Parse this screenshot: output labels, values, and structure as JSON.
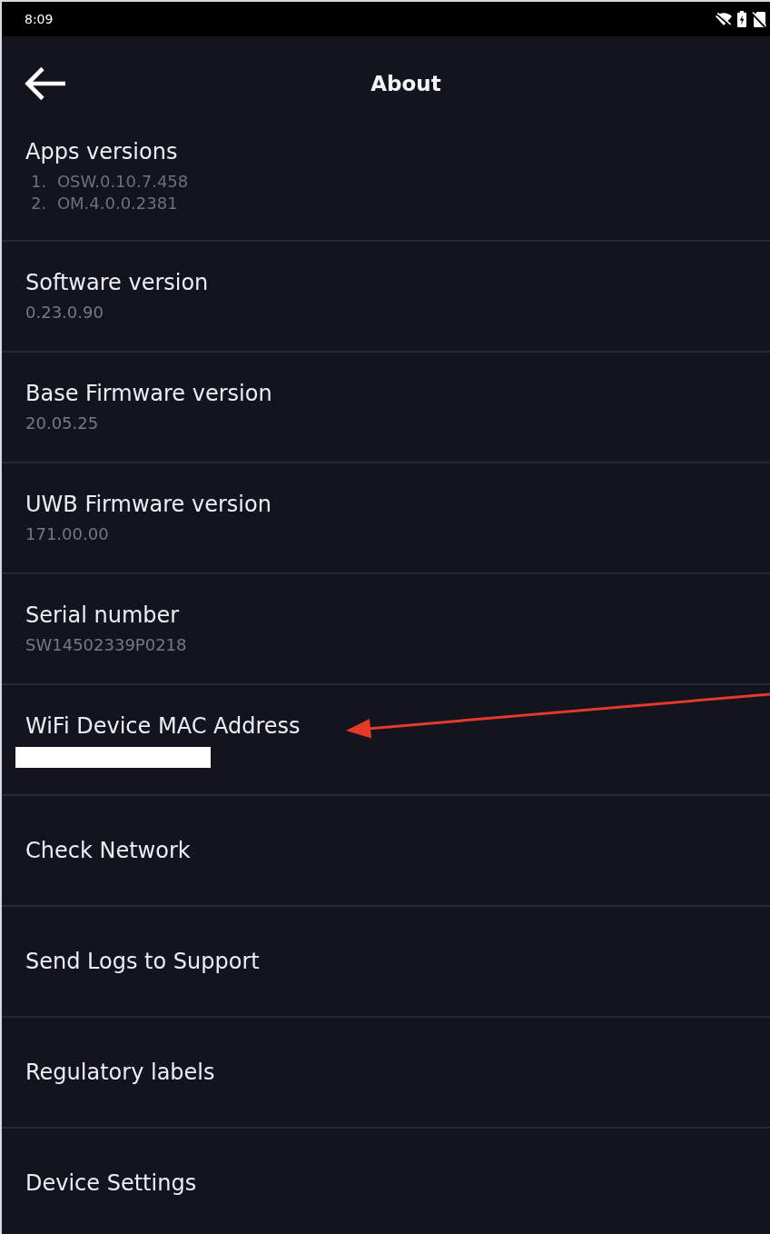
{
  "status_bar": {
    "time": "8:09"
  },
  "header": {
    "title": "About"
  },
  "items": [
    {
      "kind": "list",
      "title": "Apps versions",
      "values": [
        "1. OSW.0.10.7.458",
        "2. OM.4.0.0.2381"
      ],
      "redacted": false,
      "marked": false
    },
    {
      "kind": "info",
      "title": "Software version",
      "value": "0.23.0.90",
      "redacted": false,
      "marked": false
    },
    {
      "kind": "info",
      "title": "Base Firmware version",
      "value": "20.05.25",
      "redacted": false,
      "marked": false
    },
    {
      "kind": "info",
      "title": "UWB Firmware version",
      "value": "171.00.00",
      "redacted": false,
      "marked": false
    },
    {
      "kind": "info",
      "title": "Serial number",
      "value": "SW14502339P0218",
      "redacted": false,
      "marked": false
    },
    {
      "kind": "info",
      "title": "WiFi Device MAC Address",
      "redacted": true,
      "marked": true
    },
    {
      "kind": "action",
      "title": "Check Network",
      "redacted": false,
      "marked": false
    },
    {
      "kind": "action",
      "title": "Send Logs to Support",
      "redacted": false,
      "marked": false
    },
    {
      "kind": "action",
      "title": "Regulatory labels",
      "redacted": false,
      "marked": false
    },
    {
      "kind": "action",
      "title": "Device Settings",
      "redacted": false,
      "marked": false
    }
  ]
}
